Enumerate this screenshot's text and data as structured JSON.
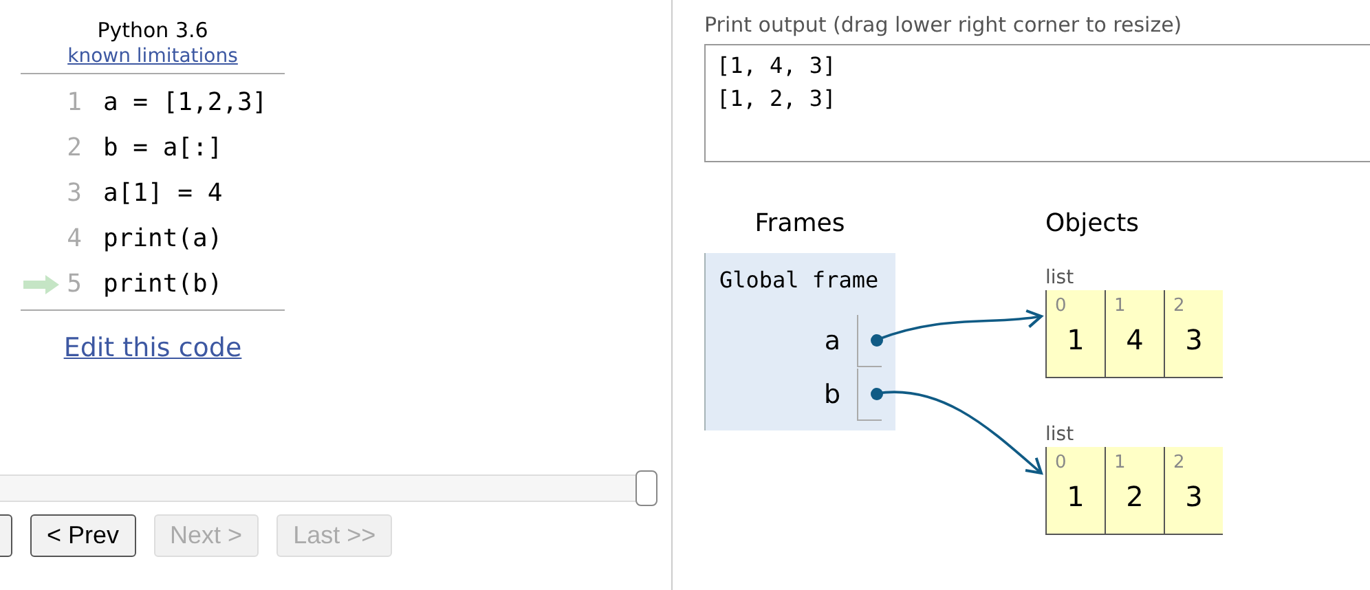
{
  "header": {
    "title": "Python 3.6",
    "link": "known limitations"
  },
  "code_lines": [
    {
      "number": "1",
      "code": "a = [1,2,3]",
      "current": false
    },
    {
      "number": "2",
      "code": "b = a[:]",
      "current": false
    },
    {
      "number": "3",
      "code": "a[1] = 4",
      "current": false
    },
    {
      "number": "4",
      "code": "print(a)",
      "current": false
    },
    {
      "number": "5",
      "code": "print(b)",
      "current": true
    }
  ],
  "edit_link": "Edit this code",
  "step_slider": {
    "level": 1
  },
  "nav_buttons": [
    {
      "label": "< Prev",
      "disabled": false
    },
    {
      "label": "Next >",
      "disabled": true
    },
    {
      "label": "Last >>",
      "disabled": true
    }
  ],
  "output": {
    "label": "Print output (drag lower right corner to resize)",
    "lines": [
      "[1, 4, 3]",
      "[1, 2, 3]"
    ]
  },
  "frames": {
    "heading": "Frames",
    "frame_title": "Global frame",
    "variables": [
      {
        "name": "a"
      },
      {
        "name": "b"
      }
    ]
  },
  "objects": {
    "heading": "Objects",
    "items": [
      {
        "type": "list",
        "cells": [
          {
            "index": "0",
            "value": "1"
          },
          {
            "index": "1",
            "value": "4"
          },
          {
            "index": "2",
            "value": "3"
          }
        ]
      },
      {
        "type": "list",
        "cells": [
          {
            "index": "0",
            "value": "1"
          },
          {
            "index": "1",
            "value": "2"
          },
          {
            "index": "2",
            "value": "3"
          }
        ]
      }
    ]
  }
}
